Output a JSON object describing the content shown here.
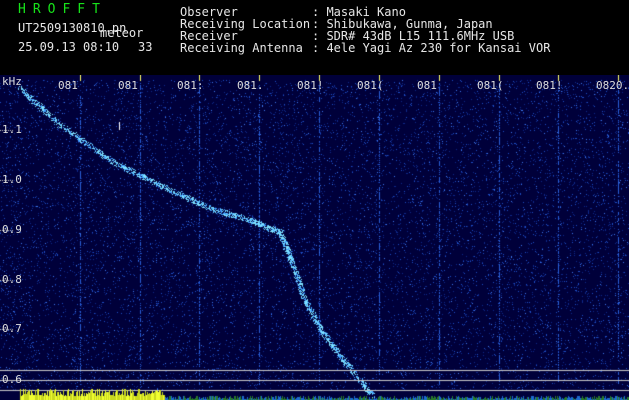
{
  "app": {
    "title": "HROFFT"
  },
  "capture": {
    "filename": "UT2509130810.pn",
    "mode": "meteor",
    "date": "25.09.13",
    "time": "08:10",
    "count": "33"
  },
  "info": [
    {
      "label": "Observer",
      "value": ": Masaki Kano"
    },
    {
      "label": "Receiving Location",
      "value": ": Shibukawa, Gunma, Japan"
    },
    {
      "label": "Receiver",
      "value": ": SDR# 43dB L15 111.6MHz USB"
    },
    {
      "label": "Receiving Antenna",
      "value": ": 4ele Yagi Az 230 for Kansai VOR"
    }
  ],
  "chart_data": {
    "type": "heatmap",
    "ylabel": "kHz",
    "y_ticks": [
      "1.1",
      "1.0",
      "0.9",
      "0.8",
      "0.7",
      "0.6"
    ],
    "x_ticks": [
      "081",
      "081",
      "081:",
      "081.",
      "081!",
      "081(",
      "081",
      "081(",
      "081!",
      "0820."
    ],
    "colors": {
      "background": "#00003a",
      "noise": "#1f4fc8",
      "trace": "#7fe3ff",
      "grid": "#c8c8c8",
      "tick": "#ffff66",
      "baseline": "#f0ff30"
    }
  }
}
